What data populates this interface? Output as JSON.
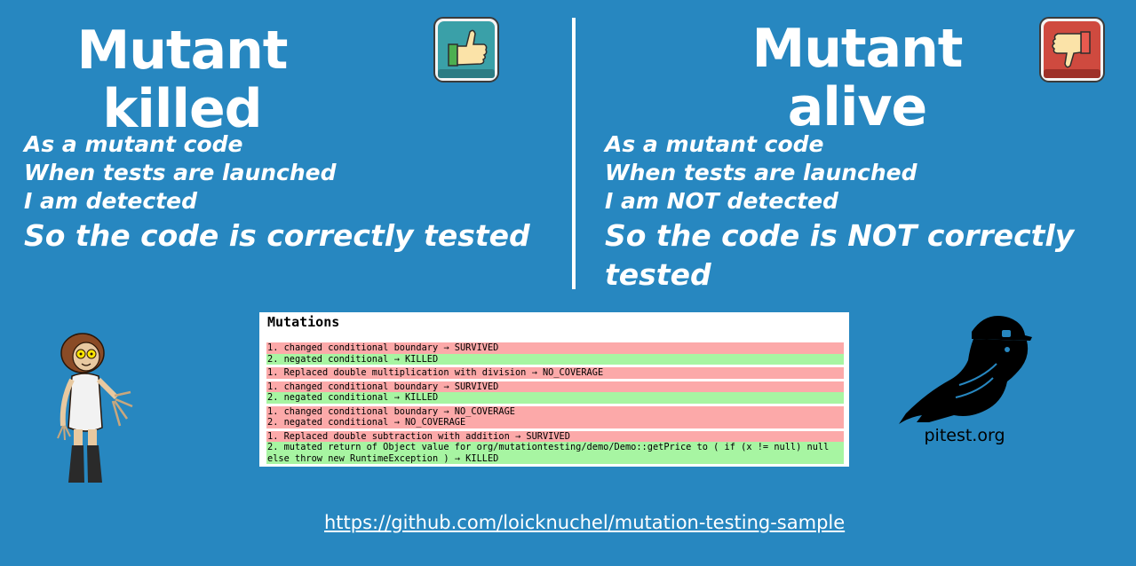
{
  "left": {
    "title": "Mutant killed",
    "lines": [
      "As a mutant code",
      "When tests are launched",
      "I am detected"
    ],
    "conclusion": "So the code is correctly tested"
  },
  "right": {
    "title": "Mutant alive",
    "lines": [
      "As a mutant code",
      "When tests are launched",
      "I am NOT detected"
    ],
    "conclusion": "So the code is NOT correctly tested"
  },
  "mutations": {
    "title": "Mutations",
    "groups": [
      [
        {
          "text": "1. changed conditional boundary → SURVIVED",
          "status": "bad"
        },
        {
          "text": "2. negated conditional → KILLED",
          "status": "good"
        }
      ],
      [
        {
          "text": "1. Replaced double multiplication with division → NO_COVERAGE",
          "status": "bad"
        }
      ],
      [
        {
          "text": "1. changed conditional boundary → SURVIVED",
          "status": "bad"
        },
        {
          "text": "2. negated conditional → KILLED",
          "status": "good"
        }
      ],
      [
        {
          "text": "1. changed conditional boundary → NO_COVERAGE",
          "status": "bad"
        },
        {
          "text": "2. negated conditional → NO_COVERAGE",
          "status": "bad"
        }
      ],
      [
        {
          "text": "1. Replaced double subtraction with addition → SURVIVED",
          "status": "bad"
        },
        {
          "text": "2. mutated return of Object value for org/mutationtesting/demo/Demo::getPrice to ( if (x != null) null else throw new RuntimeException ) → KILLED",
          "status": "good"
        }
      ]
    ]
  },
  "pitest_label": "pitest.org",
  "link": "https://github.com/loicknuchel/mutation-testing-sample",
  "icons": {
    "thumbs_up": "thumbs-up-icon",
    "thumbs_down": "thumbs-down-icon",
    "mascot": "mutant-mascot-icon",
    "bird": "pitest-bird-logo"
  },
  "colors": {
    "background": "#2787c0",
    "survived": "#fca9a9",
    "killed": "#a7f5a2"
  }
}
